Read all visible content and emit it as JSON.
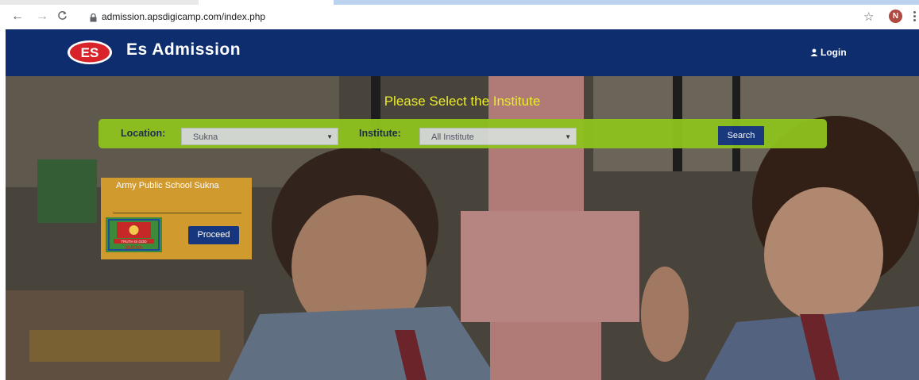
{
  "browser": {
    "url": "admission.apsdigicamp.com/index.php",
    "avatar_letter": "N",
    "icons": [
      "back-arrow-icon",
      "forward-arrow-icon",
      "reload-icon",
      "lock-icon",
      "star-icon",
      "menu-kebab-icon"
    ]
  },
  "header": {
    "logo_text": "ES",
    "brand": "Es Admission",
    "login_label": "Login",
    "background": "#0d2d6e"
  },
  "hero": {
    "title": "Please Select the Institute",
    "title_color": "#eaec2a",
    "search": {
      "location_label": "Location:",
      "location_value": "Sukna",
      "institute_label": "Institute:",
      "institute_value": "All Institute",
      "search_label": "Search",
      "bar_color": "#8ec21e"
    },
    "school_card": {
      "name": "Army Public School Sukna",
      "crest_text": "SUKNA",
      "crest_motto": "TRUTH IS GOD",
      "proceed_label": "Proceed",
      "card_color": "#d19a2e"
    }
  }
}
